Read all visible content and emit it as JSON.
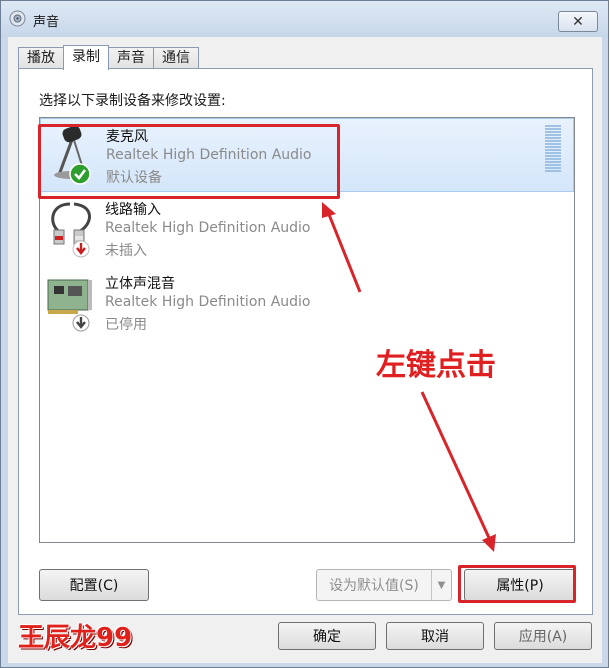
{
  "window": {
    "title": "声音",
    "close_glyph": "✕"
  },
  "tabs": [
    {
      "label": "播放",
      "active": false
    },
    {
      "label": "录制",
      "active": true
    },
    {
      "label": "声音",
      "active": false
    },
    {
      "label": "通信",
      "active": false
    }
  ],
  "instruction": "选择以下录制设备来修改设置:",
  "devices": [
    {
      "name": "麦克风",
      "driver": "Realtek High Definition Audio",
      "status": "默认设备",
      "icon": "microphone-icon",
      "badge": "green-check-icon",
      "selected": true
    },
    {
      "name": "线路输入",
      "driver": "Realtek High Definition Audio",
      "status": "未插入",
      "icon": "line-in-cable-icon",
      "badge": "red-down-arrow-icon",
      "selected": false
    },
    {
      "name": "立体声混音",
      "driver": "Realtek High Definition Audio",
      "status": "已停用",
      "icon": "sound-card-icon",
      "badge": "gray-down-arrow-icon",
      "selected": false
    }
  ],
  "buttons": {
    "configure": "配置(C)",
    "set_default": "设为默认值(S)",
    "properties": "属性(P)",
    "ok": "确定",
    "cancel": "取消",
    "apply": "应用(A)"
  },
  "annotation": "左键点击",
  "watermark": "王辰龙99",
  "colors": {
    "highlight_red": "#d8242b",
    "selection_blue": "#d4e6fa",
    "check_green": "#2e9e2e"
  }
}
